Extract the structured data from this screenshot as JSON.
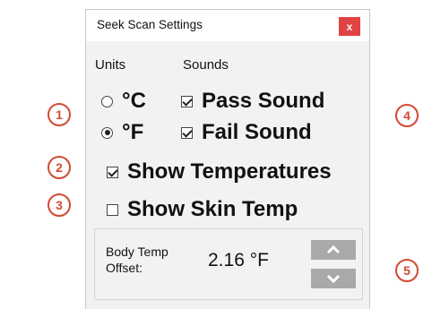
{
  "window": {
    "title": "Seek Scan Settings",
    "close_label": "x"
  },
  "units": {
    "heading": "Units",
    "celsius_label": "°C",
    "fahrenheit_label": "°F",
    "selected": "°F"
  },
  "sounds": {
    "heading": "Sounds",
    "pass_label": "Pass Sound",
    "pass_checked": true,
    "fail_label": "Fail Sound",
    "fail_checked": true
  },
  "show_temperatures": {
    "label": "Show Temperatures",
    "checked": true
  },
  "show_skin_temp": {
    "label": "Show Skin Temp",
    "checked": false
  },
  "body_temp_offset": {
    "label_line1": "Body Temp",
    "label_line2": "Offset:",
    "value": "2.16 °F"
  },
  "callouts": [
    "1",
    "2",
    "3",
    "4",
    "5"
  ],
  "colors": {
    "close_button": "#e04343",
    "callout": "#d04a33",
    "stepper": "#a9a9a9"
  }
}
